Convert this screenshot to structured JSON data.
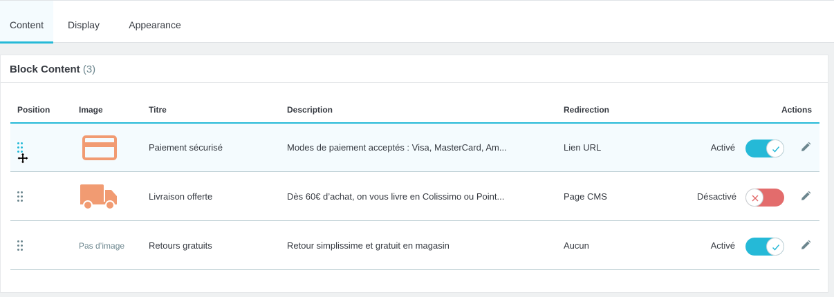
{
  "tabs": [
    {
      "label": "Content",
      "active": true
    },
    {
      "label": "Display",
      "active": false
    },
    {
      "label": "Appearance",
      "active": false
    }
  ],
  "panel": {
    "title": "Block Content",
    "count": "(3)"
  },
  "table": {
    "headers": {
      "position": "Position",
      "image": "Image",
      "titre": "Titre",
      "description": "Description",
      "redirection": "Redirection",
      "actions": "Actions"
    },
    "rows": [
      {
        "image_icon": "credit-card-icon",
        "image_text": "",
        "titre": "Paiement sécurisé",
        "description": "Modes de paiement acceptés : Visa, MasterCard, Am...",
        "redirection": "Lien URL",
        "status": "Activé",
        "enabled": true
      },
      {
        "image_icon": "truck-icon",
        "image_text": "",
        "titre": "Livraison offerte",
        "description": "Dès 60€ d’achat, on vous livre en Colissimo ou Point...",
        "redirection": "Page CMS",
        "status": "Désactivé",
        "enabled": false
      },
      {
        "image_icon": "",
        "image_text": "Pas d’image",
        "titre": "Retours gratuits",
        "description": "Retour simplissime et gratuit en magasin",
        "redirection": "Aucun",
        "status": "Activé",
        "enabled": true
      }
    ]
  },
  "colors": {
    "accent": "#25b9d7",
    "danger": "#e36c6c",
    "icon": "#f19b72"
  }
}
